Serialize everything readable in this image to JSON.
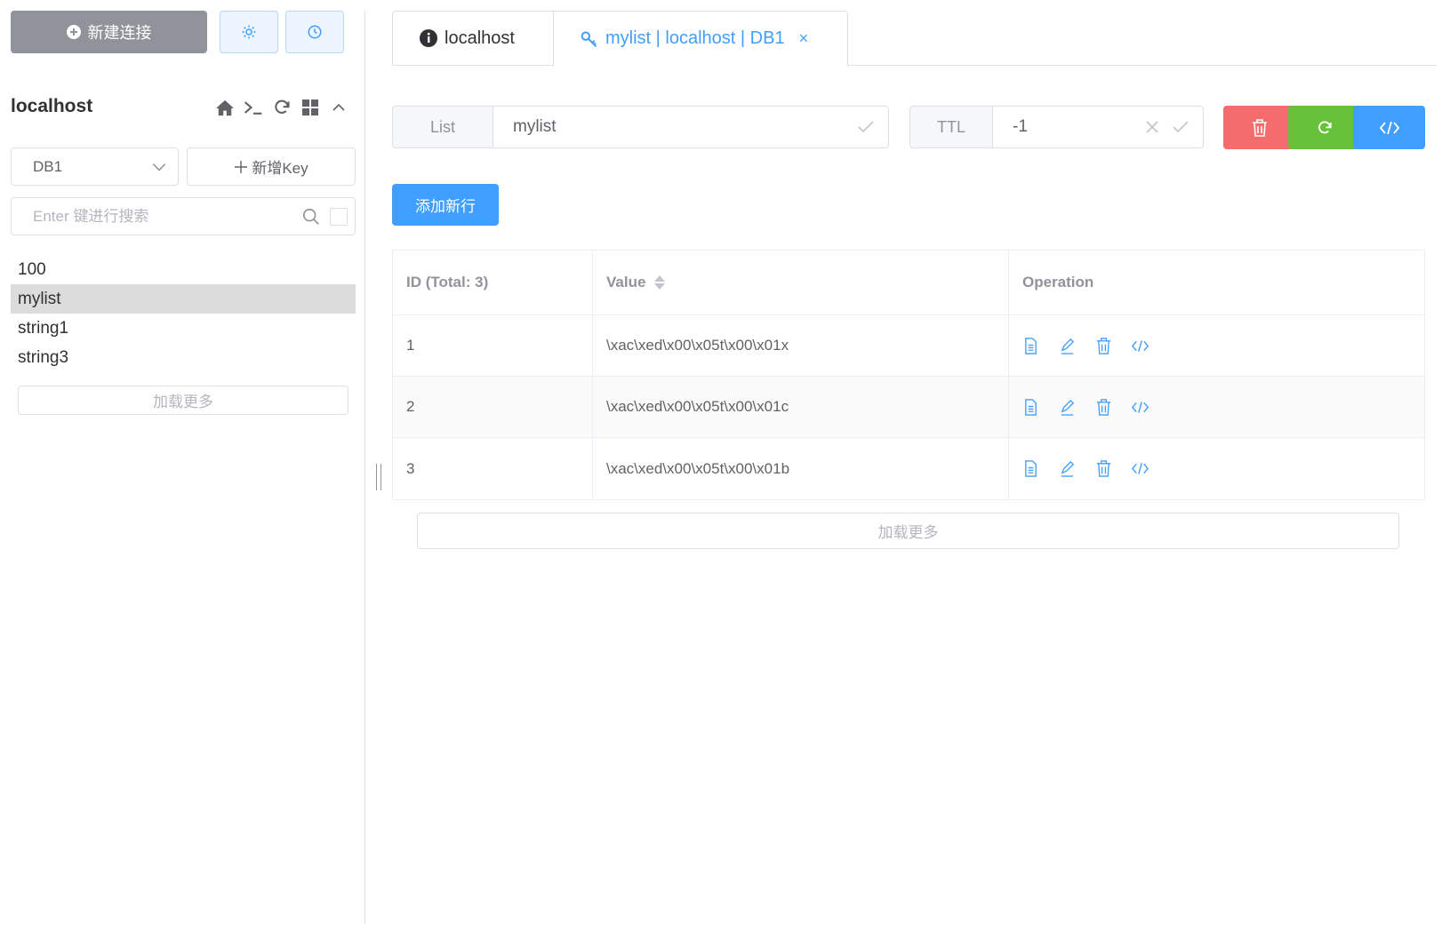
{
  "sidebar": {
    "new_connection_label": "新建连接",
    "connection_name": "localhost",
    "db_selected": "DB1",
    "add_key_label": "新增Key",
    "search_placeholder": "Enter 键进行搜索",
    "keys": [
      "100",
      "mylist",
      "string1",
      "string3"
    ],
    "active_key": "mylist",
    "load_more_label": "加载更多"
  },
  "tabs": [
    {
      "label": "localhost",
      "icon": "info-icon"
    },
    {
      "label": "mylist | localhost | DB1",
      "icon": "key-icon",
      "close": "×"
    }
  ],
  "key_header": {
    "type_label": "List",
    "key_name": "mylist",
    "ttl_label": "TTL",
    "ttl_value": "-1"
  },
  "add_row_label": "添加新行",
  "table": {
    "columns": [
      "ID (Total: 3)",
      "Value",
      "Operation"
    ],
    "rows": [
      {
        "id": "1",
        "value": "\\xac\\xed\\x00\\x05t\\x00\\x01x"
      },
      {
        "id": "2",
        "value": "\\xac\\xed\\x00\\x05t\\x00\\x01c"
      },
      {
        "id": "3",
        "value": "\\xac\\xed\\x00\\x05t\\x00\\x01b"
      }
    ]
  },
  "load_more_label": "加载更多",
  "colors": {
    "primary": "#409eff",
    "danger": "#f56c6c",
    "success": "#67c23a",
    "info": "#909399"
  }
}
